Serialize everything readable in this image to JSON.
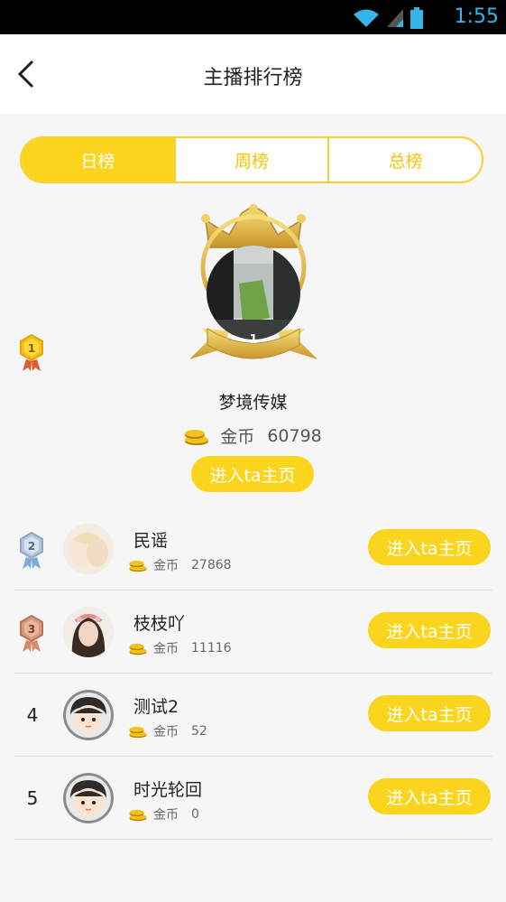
{
  "status_bar": {
    "time": "1:55"
  },
  "header": {
    "title": "主播排行榜"
  },
  "tabs": [
    {
      "label": "日榜",
      "active": true
    },
    {
      "label": "周榜",
      "active": false
    },
    {
      "label": "总榜",
      "active": false
    }
  ],
  "top1": {
    "rank_label": "1",
    "name": "梦境传媒",
    "coin_label": "金币",
    "coins": "60798",
    "button": "进入ta主页"
  },
  "list": [
    {
      "rank": "2",
      "name": "民谣",
      "coin_label": "金币",
      "coins": "27868",
      "button": "进入ta主页"
    },
    {
      "rank": "3",
      "name": "枝枝吖",
      "coin_label": "金币",
      "coins": "11116",
      "button": "进入ta主页"
    },
    {
      "rank": "4",
      "name": "测试2",
      "coin_label": "金币",
      "coins": "52",
      "button": "进入ta主页"
    },
    {
      "rank": "5",
      "name": "时光轮回",
      "coin_label": "金币",
      "coins": "0",
      "button": "进入ta主页"
    }
  ],
  "colors": {
    "accent": "#fbd51d",
    "tab_text": "#f6c400"
  }
}
